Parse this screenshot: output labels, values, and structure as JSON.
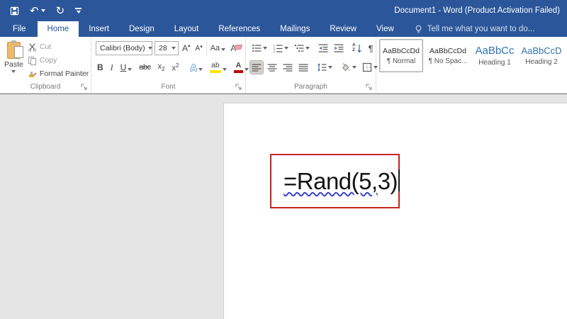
{
  "colors": {
    "titlebar_blue": "#2b579a",
    "active_tab_text": "#2b579a",
    "ribbon_bg": "#ffffff",
    "document_bg": "#e6e5e5",
    "annotation_red": "#c3261d",
    "squiggle_blue": "#3b44c8",
    "heading_blue": "#2e74b5",
    "highlight_yellow": "#ffe500",
    "font_color_red": "#c00000"
  },
  "titlebar": {
    "title": "Document1 - Word (Product Activation Failed)",
    "qat_icons": [
      "save-icon",
      "undo-icon",
      "redo-icon",
      "customize-quick-access-toolbar-icon"
    ]
  },
  "icon_glyphs": {
    "undo": "↶",
    "redo": "↻",
    "pilcrow": "¶"
  },
  "tabs": [
    {
      "label": "File"
    },
    {
      "label": "Home",
      "active": true
    },
    {
      "label": "Insert"
    },
    {
      "label": "Design"
    },
    {
      "label": "Layout"
    },
    {
      "label": "References"
    },
    {
      "label": "Mailings"
    },
    {
      "label": "Review"
    },
    {
      "label": "View"
    }
  ],
  "tellme": {
    "text": "Tell me what you want to do..."
  },
  "ribbon": {
    "clipboard": {
      "group_label": "Clipboard",
      "paste_label": "Paste",
      "cut_label": "Cut",
      "copy_label": "Copy",
      "format_painter_label": "Format Painter"
    },
    "font": {
      "group_label": "Font",
      "font_name": "Calibri (Body)",
      "font_size": "28",
      "grow_font": "A",
      "shrink_font": "A",
      "change_case": "Aa",
      "clear_formatting": "A",
      "bold": "B",
      "italic": "I",
      "underline": "U",
      "strikethrough": "abc",
      "subscript_base": "x",
      "subscript_script": "2",
      "superscript_base": "x",
      "superscript_script": "2",
      "text_effects": "A",
      "highlight": "ab",
      "font_color": "A"
    },
    "paragraph": {
      "group_label": "Paragraph",
      "sort_a": "A",
      "sort_z": "Z"
    },
    "styles": {
      "items": [
        {
          "preview": "AaBbCcDd",
          "name": "¶ Normal",
          "selected": true
        },
        {
          "preview": "AaBbCcDd",
          "name": "¶ No Spac...",
          "selected": false
        },
        {
          "preview": "AaBbCc",
          "name": "Heading 1",
          "selected": false
        },
        {
          "preview": "AaBbCcD",
          "name": "Heading 2",
          "selected": false
        }
      ]
    }
  },
  "document": {
    "text_flagged": "=Rand(5,",
    "text_rest": "3)"
  }
}
